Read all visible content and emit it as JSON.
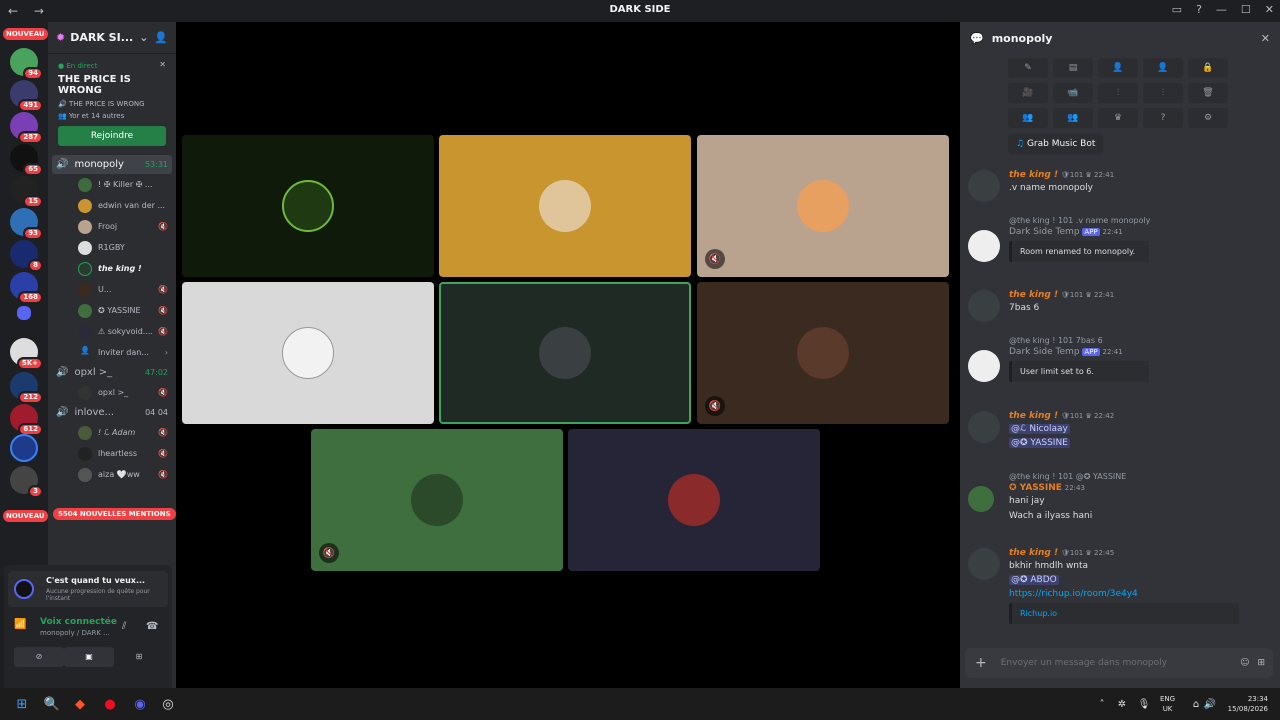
{
  "window": {
    "title": "DARK SIDE"
  },
  "servers": {
    "nouveau_label": "NOUVEAU",
    "badges": [
      "94",
      "491",
      "287",
      "65",
      "15",
      "93",
      "8",
      "168",
      "5K+",
      "212",
      "612",
      "3"
    ]
  },
  "sidebar": {
    "server_name": "DARK SI...",
    "event": {
      "status": "En direct",
      "title": "THE PRICE IS WRONG",
      "subtitle": "THE PRICE IS WRONG",
      "participants": "Yor et 14 autres",
      "join_label": "Rejoindre"
    },
    "voice_channels": [
      {
        "name": "monopoly",
        "time": "53:31"
      },
      {
        "name": "opxl >_",
        "time": "47:02"
      },
      {
        "name": "inlove...",
        "time": "04 04"
      }
    ],
    "members": [
      "! ✠ Killer ✠ ...",
      "edwin van der ...",
      "Frooj",
      "R1GBY",
      "the king !",
      "U...",
      "✪ YASSINE",
      "⚠ sokyvoid....",
      "Inviter dan..."
    ],
    "members2": [
      "opxl >_"
    ],
    "members3": [
      "! ℒ Adam",
      "lheartless",
      "aiza 🤍ww"
    ],
    "mentions_label": "5504 NOUVELLES MENTIONS",
    "activity": {
      "title": "C'est quand tu veux...",
      "desc": "Aucune progression de quête pour l'instant"
    },
    "voice": {
      "status": "Voix connectée",
      "channel": "monopoly / DARK ..."
    }
  },
  "chat": {
    "channel": "monopoly",
    "music_button": "Grab Music Bot",
    "messages": [
      {
        "user": "the king !",
        "level": "101",
        "time": "22:41",
        "text": ".v name monopoly"
      },
      {
        "reply": "@the king !  101  .v name monopoly",
        "user": "Dark Side Temp",
        "tag": "APP",
        "time": "22:41",
        "embed": "Room renamed to monopoly."
      },
      {
        "user": "the king !",
        "level": "101",
        "time": "22:41",
        "text": "7bas 6"
      },
      {
        "reply": "@the king !  101  7bas 6",
        "user": "Dark Side Temp",
        "tag": "APP",
        "time": "22:41",
        "embed": "User limit set to 6."
      },
      {
        "user": "the king !",
        "level": "101",
        "time": "22:42",
        "m1": "@ℒ Nicolaay",
        "m2": "@✪ YASSINE"
      },
      {
        "reply": "@the king !  101  @✪ YASSINE",
        "user": "✪ YASSINE",
        "time": "22:43",
        "text": "hani jay",
        "text2": "Wach a ilyass hani"
      },
      {
        "user": "the king !",
        "level": "101",
        "time": "22:45",
        "text": "bkhir hmdlh wnta",
        "m1": "@✪ ABDO",
        "link": "https://richup.io/room/3e4y4",
        "embed": "Richup.io"
      }
    ],
    "composer_placeholder": "Envoyer un message dans monopoly"
  },
  "taskbar": {
    "lang": "ENG",
    "region": "UK",
    "time": "23:34",
    "date": "15/08/2026"
  }
}
